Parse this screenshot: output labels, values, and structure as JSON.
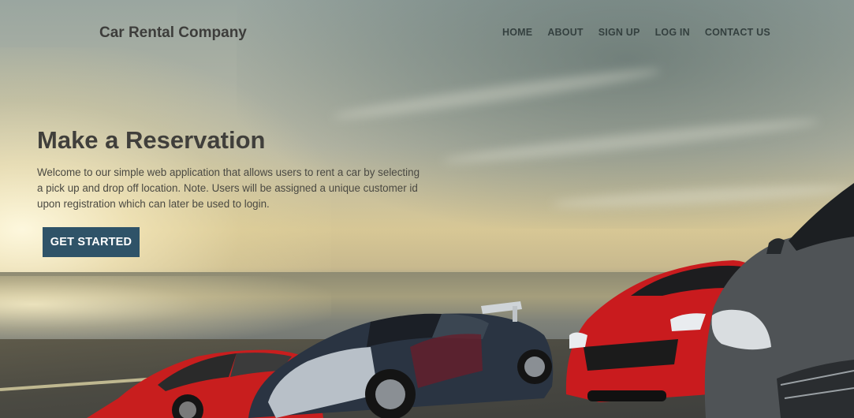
{
  "header": {
    "brand": "Car Rental Company",
    "nav": [
      {
        "label": "HOME"
      },
      {
        "label": "ABOUT"
      },
      {
        "label": "SIGN UP"
      },
      {
        "label": "LOG IN"
      },
      {
        "label": "CONTACT US"
      }
    ]
  },
  "hero": {
    "title": "Make a Reservation",
    "description": "Welcome to our simple web application that allows users to rent a car by selecting a pick up and drop off location. Note. Users will be assigned a unique customer id upon registration which can later be used to login.",
    "cta_label": "GET STARTED"
  },
  "colors": {
    "cta_background": "#2f5368",
    "cta_text": "#ffffff",
    "heading_text": "#403f3b",
    "nav_text": "#34403f"
  }
}
